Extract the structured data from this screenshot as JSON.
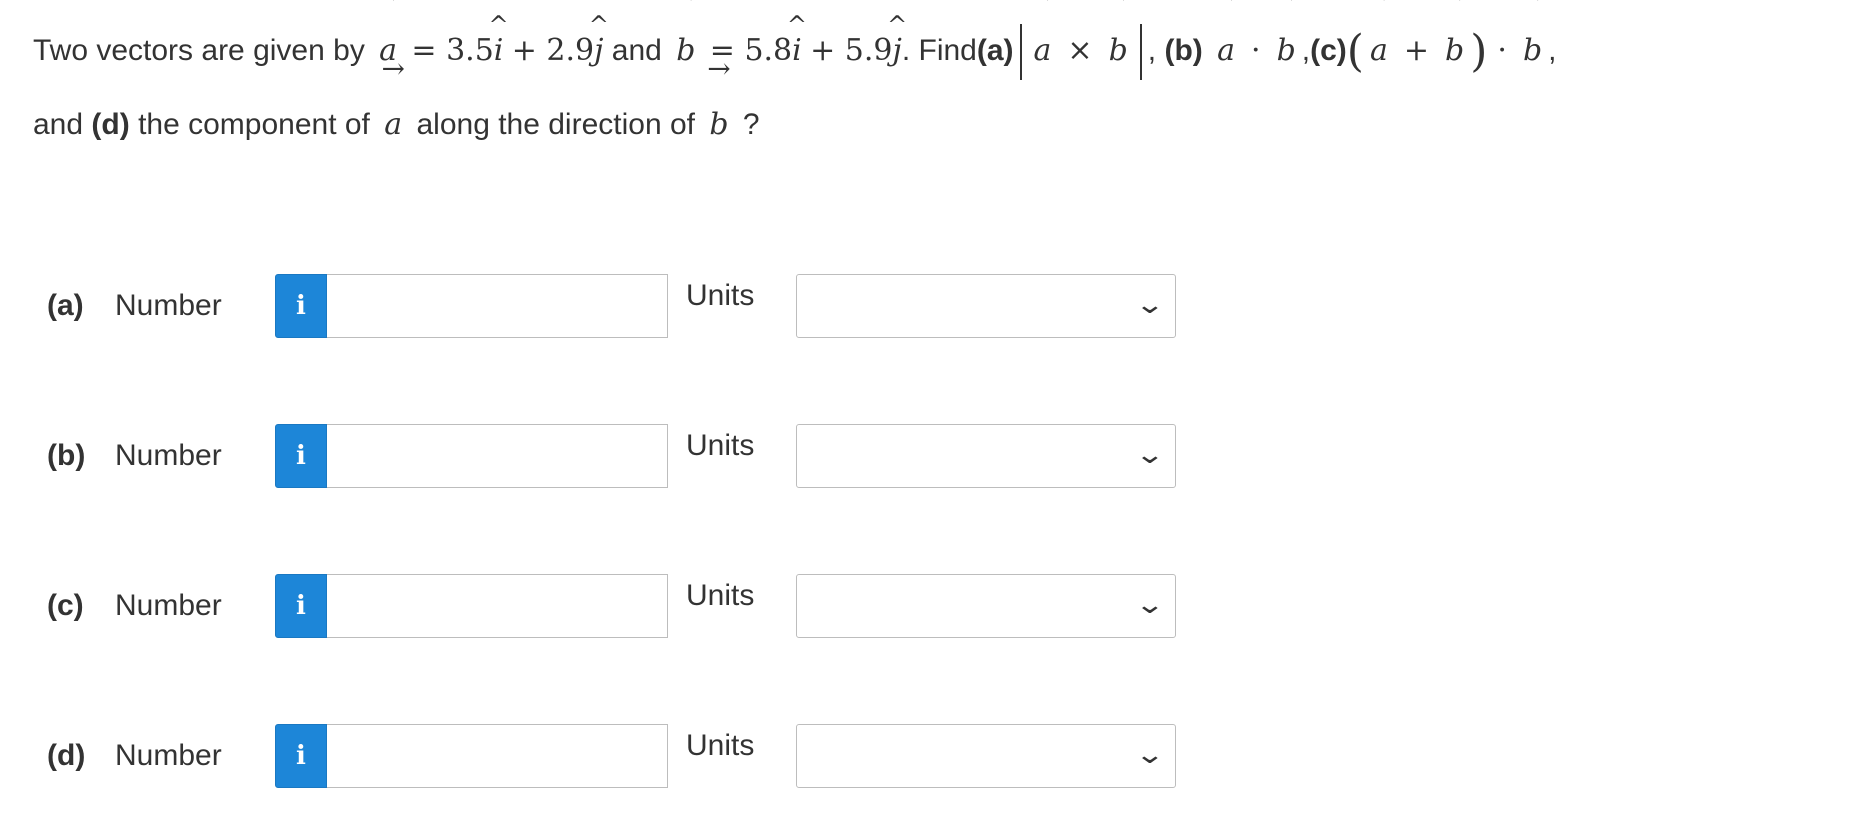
{
  "question": {
    "intro": "Two vectors are given by",
    "vec_a": "a",
    "vec_b": "b",
    "arrow": "→",
    "eq_a": "= 3.5",
    "i_hat": "i",
    "plus_a": "+ 2.9",
    "j_hat": "j",
    "and_text": "and",
    "eq_b": "= 5.8",
    "plus_b": "+ 5.9",
    "period": ".",
    "find_text": "Find",
    "part_a": "(a)",
    "cross": "×",
    "comma_b": ",",
    "part_b": "(b)",
    "dot": "·",
    "comma_c": ",",
    "part_c": "(c)",
    "lparen": "(",
    "plus_c": "+",
    "rparen": ")",
    "trailing_comma": ",",
    "line2_and": "and",
    "part_d": "(d)",
    "line2_text": "the component of",
    "along_text": "along the direction of",
    "question_mark": "?"
  },
  "caret": "^",
  "answers": [
    {
      "part": "(a)",
      "number_label": "Number",
      "info": "i",
      "value": "",
      "units_label": "Units",
      "units_value": ""
    },
    {
      "part": "(b)",
      "number_label": "Number",
      "info": "i",
      "value": "",
      "units_label": "Units",
      "units_value": ""
    },
    {
      "part": "(c)",
      "number_label": "Number",
      "info": "i",
      "value": "",
      "units_label": "Units",
      "units_value": ""
    },
    {
      "part": "(d)",
      "number_label": "Number",
      "info": "i",
      "value": "",
      "units_label": "Units",
      "units_value": ""
    }
  ],
  "icons": {
    "info": "info-icon",
    "dropdown": "chevron-down-icon"
  },
  "colors": {
    "info_button": "#1d86d8",
    "text": "#333333",
    "border": "#bdbdbd"
  }
}
